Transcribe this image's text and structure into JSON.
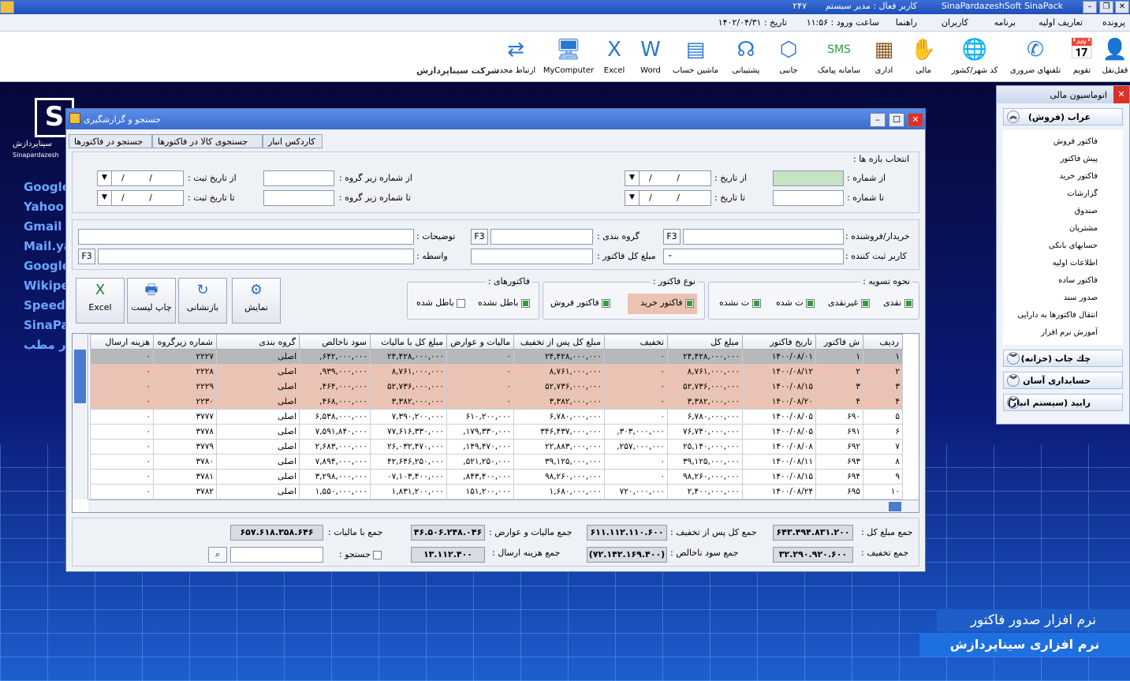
{
  "window_title": "SinaPardazeshSoft SinaPack",
  "active_user": "کاربر فعال : مدیر سیستم",
  "user_num": "۲۴۷",
  "menu": [
    "پرونده",
    "تعاریف اولیه",
    "برنامه",
    "کاربران",
    "راهنما"
  ],
  "login_time": "ساعت ورود : ۱۱:۵۶",
  "date": "تاریخ : ۱۴۰۲/۰۴/۳۱",
  "company": "شرکت سیناپردازش",
  "toolbar": [
    {
      "label": "قفل‌نقل",
      "icon": "user-icon"
    },
    {
      "label": "تقویم",
      "icon": "calendar-icon"
    },
    {
      "label": "تلفنهای ضروری",
      "icon": "phone-icon"
    },
    {
      "label": "کد شهر/کشور",
      "icon": "globe-icon"
    },
    {
      "label": "مالی",
      "icon": "handshake-icon"
    },
    {
      "label": "اداری",
      "icon": "building-icon"
    },
    {
      "label": "سامانه پیامک",
      "icon": "sms-icon"
    },
    {
      "label": "جانبی",
      "icon": "box-icon"
    },
    {
      "label": "پشتیبانی",
      "icon": "headset-icon"
    },
    {
      "label": "ماشین حساب",
      "icon": "calculator-icon"
    },
    {
      "label": "Word",
      "icon": "word-icon"
    },
    {
      "label": "Excel",
      "icon": "excel-icon"
    },
    {
      "label": "MyComputer",
      "icon": "computer-icon"
    },
    {
      "label": "ارتباط مجدد",
      "icon": "refresh-icon"
    }
  ],
  "desktop": {
    "logo_text": "سیناپردازش",
    "logo_sub": "Sinapardazesh",
    "links": [
      "Google",
      "Yahoo",
      "Gmail",
      "Mail.ya",
      "Google",
      "Wikipe",
      "Speed",
      "SinaPa",
      "نرم افزار مطب"
    ],
    "banner1": "نرم افزار صدور فاکتور",
    "banner2": "نرم افزاری سیناپردازش"
  },
  "right_panel": {
    "title": "اتوماسیون مالی",
    "group_sales": "عراب (فروش)",
    "items": [
      "فاکتور فروش",
      "پیش فاکتور",
      "فاکتور خرید",
      "گزارشات",
      "صندوق",
      "مشتریان",
      "حسابهای بانکی",
      "اطلاعات اولیه",
      "فاکتور ساده",
      "صدور سند",
      "انتقال فاکتورها به دارایی",
      "آموزش نرم افزار"
    ],
    "group_check": "چك جاب (خزانه)",
    "group_acc": "حسابداری آسان",
    "group_store": "رابید (سیستم انبار)"
  },
  "search_window": {
    "title": "جستجو و گزارشگیری",
    "tabs": [
      "جستجو در فاکتورها",
      "جستجوی کالا در فاکتورها",
      "کاردکس انبار"
    ],
    "range_title": "انتخاب بازه ها :",
    "from_number": "از شماره :",
    "to_number": "تا شماره :",
    "from_date": "از تاریخ :",
    "to_date": "تا تاریخ :",
    "from_subgroup": "از شماره زیر گروه :",
    "to_subgroup": "تا شماره زیر گروه :",
    "from_reg_date": "از تاریخ ثبت :",
    "to_reg_date": "تا تاریخ ثبت :",
    "date_placeholder": "/    /",
    "buyer": "خریدار/فروشنده :",
    "group": "گروه بندی :",
    "desc": "توضیحات :",
    "reg_user": "کاربر ثبت کننده :",
    "total": "مبلغ کل فاکتور :",
    "agent": "واسطه :",
    "f3": "F3",
    "buttons": {
      "show": "نمایش",
      "refresh": "بازنشانی",
      "print": "چاپ لیست",
      "excel": "Excel"
    },
    "settle_title": "نحوه تسویه :",
    "settle": [
      "نقدی",
      "غیرنقدی",
      "ت شده",
      "ت نشده"
    ],
    "type_title": "نوع فاکتور :",
    "types": [
      "فاکتور خرید",
      "فاکتور فروش"
    ],
    "inv_title": "فاکتورهای :",
    "inv": [
      "باطل نشده",
      "باطل شده"
    ]
  },
  "table": {
    "columns": [
      "ردیف",
      "ش فاکتور",
      "تاریخ فاکتور",
      "مبلغ کل",
      "تخفیف",
      "مبلغ کل پس از تخفیف",
      "مالیات و عوارض",
      "مبلغ کل با مالیات",
      "سود ناخالص",
      "گروه بندی",
      "شماره زیرگروه",
      "هزینه ارسال"
    ],
    "rows": [
      [
        "۱",
        "۱",
        "۱۴۰۰/۰۸/۰۱",
        "۲۴,۴۲۸,۰۰۰,۰۰۰",
        "۰",
        "۲۴,۴۲۸,۰۰۰,۰۰۰",
        "۰",
        "۲۴,۴۲۸,۰۰۰,۰۰۰",
        "۶۴۲,۰۰۰,۰۰۰,",
        "اصلی",
        "۲۲۲۷",
        "۰"
      ],
      [
        "۲",
        "۲",
        "۱۴۰۰/۰۸/۱۲",
        "۸,۷۶۱,۰۰۰,۰۰۰",
        "۰",
        "۸,۷۶۱,۰۰۰,۰۰۰",
        "۰",
        "۸,۷۶۱,۰۰۰,۰۰۰",
        "۹۳۹,۰۰۰,۰۰۰,",
        "اصلی",
        "۲۲۲۸",
        "۰"
      ],
      [
        "۳",
        "۳",
        "۱۴۰۰/۰۸/۱۵",
        "۵۲,۷۳۶,۰۰۰,۰۰۰",
        "۰",
        "۵۲,۷۳۶,۰۰۰,۰۰۰",
        "۰",
        "۵۲,۷۳۶,۰۰۰,۰۰۰",
        "۴۶۴,۰۰۰,۰۰۰,",
        "اصلی",
        "۲۲۲۹",
        "۰"
      ],
      [
        "۴",
        "۴",
        "۱۴۰۰/۰۸/۲۰",
        "۳,۳۸۲,۰۰۰,۰۰۰",
        "۰",
        "۳,۳۸۲,۰۰۰,۰۰۰",
        "۰",
        "۳,۳۸۲,۰۰۰,۰۰۰",
        "۴۶۸,۰۰۰,۰۰۰,",
        "اصلی",
        "۲۲۳۰",
        "۰"
      ],
      [
        "۵",
        "۶۹۰",
        "۱۴۰۰/۰۸/۰۵",
        "۶,۷۸۰,۰۰۰,۰۰۰",
        "۰",
        "۶,۷۸۰,۰۰۰,۰۰۰",
        "۶۱۰,۲۰۰,۰۰۰",
        "۷,۳۹۰,۲۰۰,۰۰۰",
        "۶,۵۳۸,۰۰۰,۰۰۰",
        "اصلی",
        "۳۷۷۷",
        "۰"
      ],
      [
        "۶",
        "۶۹۱",
        "۱۴۰۰/۰۸/۰۵",
        "۷۶,۷۴۰,۰۰۰,۰۰۰",
        "۳۰۳,۰۰۰,۰۰۰,",
        "۳۴۶,۴۳۷,۰۰۰,۰۰۰",
        "۱۷۹,۳۳۰,۰۰۰,",
        "۷۷,۶۱۶,۳۳۰,۰۰۰",
        "۷,۵۹۱,۸۴۰,۰۰۰",
        "اصلی",
        "۳۷۷۸",
        "۰"
      ],
      [
        "۷",
        "۶۹۲",
        "۱۴۰۰/۰۸/۰۸",
        "۲۵,۱۴۰,۰۰۰,۰۰۰",
        "۲۵۷,۰۰۰,۰۰۰,",
        "۲۲,۸۸۳,۰۰۰,۰۰۰",
        "۱۴۹,۴۷۰,۰۰۰,",
        "۲۶,۰۳۲,۴۷۰,۰۰۰",
        "۲,۶۸۳,۰۰۰,۰۰۰",
        "اصلی",
        "۳۷۷۹",
        "۰"
      ],
      [
        "۸",
        "۶۹۳",
        "۱۴۰۰/۰۸/۱۱",
        "۳۹,۱۲۵,۰۰۰,۰۰۰",
        "۰",
        "۳۹,۱۲۵,۰۰۰,۰۰۰",
        "۵۲۱,۲۵۰,۰۰۰,",
        "۴۲,۶۴۶,۲۵۰,۰۰۰",
        "۷,۸۹۴,۰۰۰,۰۰۰",
        "اصلی",
        "۳۷۸۰",
        "۰"
      ],
      [
        "۹",
        "۶۹۴",
        "۱۴۰۰/۰۸/۱۵",
        "۹۸,۲۶۰,۰۰۰,۰۰۰",
        "۰",
        "۹۸,۲۶۰,۰۰۰,۰۰۰",
        "۸۴۳,۴۰۰,۰۰۰,",
        "۰۷,۱۰۳,۴۰۰,۰۰۰",
        "۳,۲۹۸,۰۰۰,۰۰۰",
        "اصلی",
        "۳۷۸۱",
        "۰"
      ],
      [
        "۱۰",
        "۶۹۵",
        "۱۴۰۰/۰۸/۲۴",
        "۲,۴۰۰,۰۰۰,۰۰۰",
        "۷۲۰,۰۰۰,۰۰۰",
        "۱,۶۸۰,۰۰۰,۰۰۰",
        "۱۵۱,۲۰۰,۰۰۰",
        "۱,۸۳۱,۲۰۰,۰۰۰",
        "۱,۵۵۰,۰۰۰,۰۰۰",
        "اصلی",
        "۳۷۸۲",
        "۰"
      ]
    ]
  },
  "totals": {
    "sum_total_label": "جمع مبلغ کل :",
    "sum_total": "۶۴۳.۴۹۴.۸۳۱.۲۰۰",
    "sum_after_disc_label": "جمع کل پس از تخفیف :",
    "sum_after_disc": "۶۱۱.۱۱۲.۱۱۰.۶۰۰",
    "sum_tax_label": "جمع مالیات و عوارض :",
    "sum_tax": "۴۶.۵۰۶.۲۴۸.۰۴۶",
    "sum_with_tax_label": "جمع با مالیات :",
    "sum_with_tax": "۶۵۷.۶۱۸.۳۵۸.۶۴۶",
    "sum_disc_label": "جمع تخفیف :",
    "sum_disc": "۳۲.۲۹۰.۹۲۰.۶۰۰",
    "sum_profit_label": "جمع سود ناخالص :",
    "sum_profit": "(۷۲.۱۴۲.۱۶۹.۴۰۰)",
    "sum_ship_label": "جمع هزینه ارسال :",
    "sum_ship": "۱۳.۱۱۲.۴۰۰",
    "search_label": "جستجو :"
  }
}
